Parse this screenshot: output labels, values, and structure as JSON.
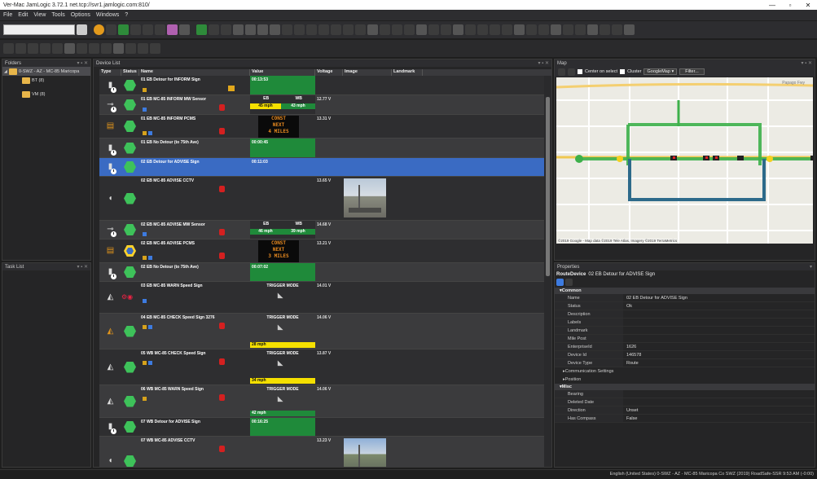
{
  "window": {
    "title": "Ver-Mac JamLogic 3.72.1 net.tcp://svr1.jamlogic.com:810/"
  },
  "menu": [
    "File",
    "Edit",
    "View",
    "Tools",
    "Options",
    "Windows",
    "?"
  ],
  "folders": {
    "title": "Folders",
    "root": "0-SWZ - AZ - MC-85 Maricopa",
    "children": [
      "BT (8)",
      "VM (8)"
    ]
  },
  "task_list": {
    "title": "Task List"
  },
  "device_list": {
    "title": "Device List",
    "columns": [
      "Type",
      "Status",
      "Name",
      "Value",
      "Voltage",
      "Image",
      "Landmark"
    ],
    "rows": [
      {
        "name": "01 EB Detour for INFORM Sign",
        "value": "00:13:53",
        "voltage": ""
      },
      {
        "name": "01 EB MC-85 INFORM MW Sensor",
        "eb": "EB",
        "wb": "WB",
        "spd_eb": "45 mph",
        "spd_wb": "43 mph",
        "voltage": "12.77 V"
      },
      {
        "name": "01 EB MC-85 INFORM PCMS",
        "msg": [
          "CONST",
          "NEXT",
          "4 MILES"
        ],
        "voltage": "13.31 V"
      },
      {
        "name": "01 EB No Detour (to 75th Ave)",
        "value": "00:00:45",
        "voltage": ""
      },
      {
        "name": "02 EB Detour for ADVISE Sign",
        "value": "00:11:03",
        "voltage": ""
      },
      {
        "name": "02 EB MC-85 ADVISE CCTV",
        "voltage": "13.65 V"
      },
      {
        "name": "02 EB MC-85 ADVISE MW Sensor",
        "eb": "EB",
        "wb": "WB",
        "spd_eb": "46 mph",
        "spd_wb": "39 mph",
        "voltage": "14.68 V"
      },
      {
        "name": "02 EB MC-85 ADVISE PCMS",
        "msg": [
          "CONST",
          "NEXT",
          "3 MILES"
        ],
        "voltage": "13.21 V"
      },
      {
        "name": "02 EB No Detour (to 75th Ave)",
        "value": "00:07:02",
        "voltage": ""
      },
      {
        "name": "03 EB MC-85 WARN Speed Sign",
        "value": "TRIGGER MODE",
        "voltage": "14.01 V"
      },
      {
        "name": "04 EB MC-85 CHECK Speed Sign 3276",
        "value": "TRIGGER MODE",
        "speed": "28 mph",
        "voltage": "14.06 V"
      },
      {
        "name": "05 WB MC-85 CHECK Speed Sign",
        "value": "TRIGGER MODE",
        "speed": "34 mph",
        "voltage": "13.87 V"
      },
      {
        "name": "06 WB MC-85 WARN Speed Sign",
        "value": "TRIGGER MODE",
        "speed": "42 mph",
        "voltage": "14.06 V"
      },
      {
        "name": "07 WB Detour for ADVISE Sign",
        "value": "00:16:25",
        "voltage": ""
      },
      {
        "name": "07 WB MC-85 ADVISE CCTV",
        "voltage": "13.23 V"
      }
    ]
  },
  "map": {
    "title": "Map",
    "center_on_select": "Center on select",
    "cluster": "Cluster",
    "provider": "GoogleMap",
    "filter": "Filter...",
    "attribution": "©2019 Google - Map data ©2019 Tele Atlas, Imagery ©2019 TerraMetrics",
    "road_label": "Papago Fwy"
  },
  "properties": {
    "title": "Properties",
    "header_label": "RouteDevice",
    "header_value": "02 EB Detour for ADVISE Sign",
    "common_label": "Common",
    "common": [
      {
        "k": "Name",
        "v": "02 EB Detour for ADVISE Sign"
      },
      {
        "k": "Status",
        "v": "Ok"
      },
      {
        "k": "Description",
        "v": ""
      },
      {
        "k": "Labels",
        "v": ""
      },
      {
        "k": "Landmark",
        "v": ""
      },
      {
        "k": "Mile Post",
        "v": ""
      },
      {
        "k": "EnterpriseId",
        "v": "1626"
      },
      {
        "k": "Device Id",
        "v": "146578"
      },
      {
        "k": "Device Type",
        "v": "Route"
      }
    ],
    "sub": [
      "Communication Settings",
      "Position"
    ],
    "misc_label": "Misc",
    "misc": [
      {
        "k": "Bearing",
        "v": ""
      },
      {
        "k": "Deleted Date",
        "v": ""
      },
      {
        "k": "Direction",
        "v": "Unset"
      },
      {
        "k": "Has Compass",
        "v": "False"
      }
    ]
  },
  "status_bar": "English (United States) 0-SWZ - AZ - MC-85 Maricopa Co SWZ (2019) RoadSafe-SSR 9:53 AM (-0:00)"
}
